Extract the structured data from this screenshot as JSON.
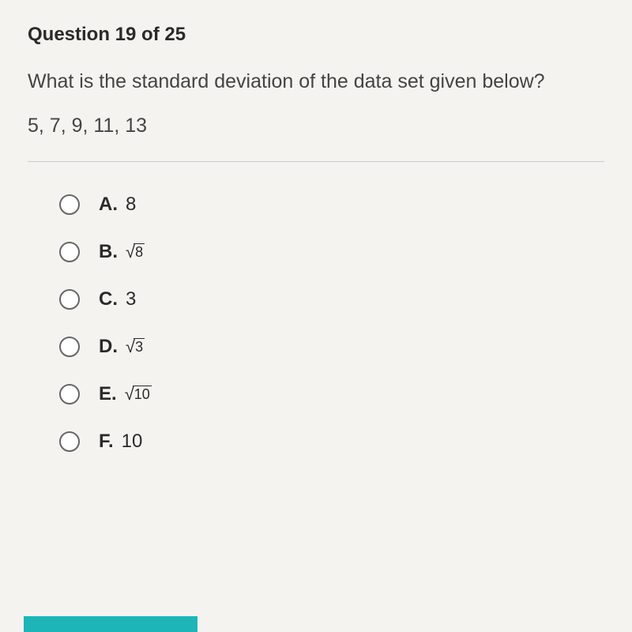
{
  "header": {
    "question_number": "Question 19 of 25"
  },
  "question": {
    "text": "What is the standard deviation of the data set given below?",
    "data_set": "5, 7, 9, 11, 13"
  },
  "options": [
    {
      "letter": "A.",
      "value": "8",
      "is_sqrt": false
    },
    {
      "letter": "B.",
      "value": "8",
      "is_sqrt": true
    },
    {
      "letter": "C.",
      "value": "3",
      "is_sqrt": false
    },
    {
      "letter": "D.",
      "value": "3",
      "is_sqrt": true
    },
    {
      "letter": "E.",
      "value": "10",
      "is_sqrt": true
    },
    {
      "letter": "F.",
      "value": "10",
      "is_sqrt": false
    }
  ]
}
